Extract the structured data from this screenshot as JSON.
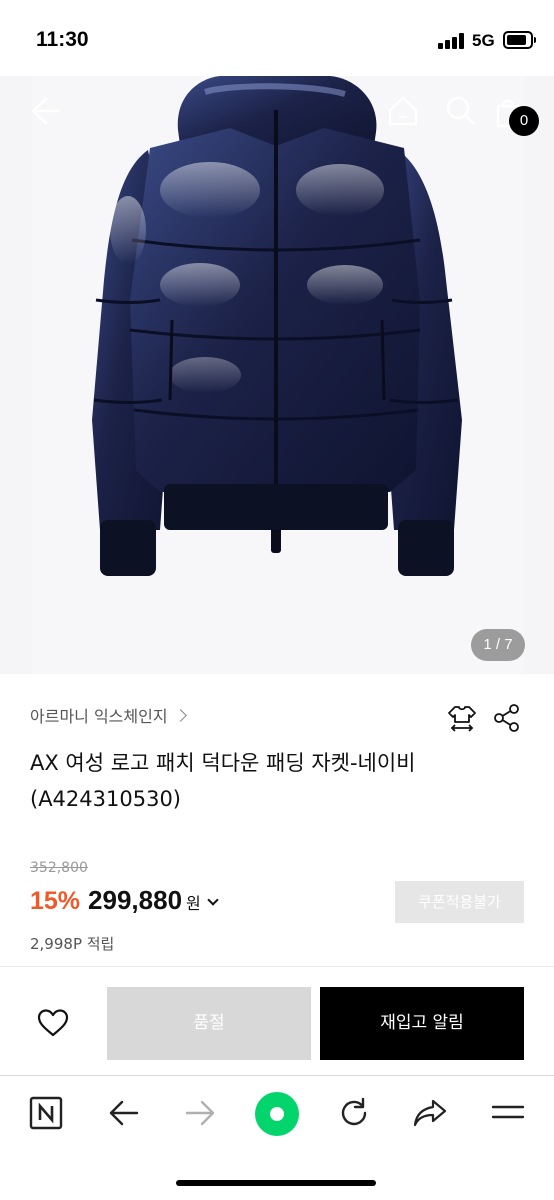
{
  "status_bar": {
    "time": "11:30",
    "network": "5G"
  },
  "header": {
    "back_icon": "arrow-left-icon",
    "home_icon": "home-icon",
    "search_icon": "search-icon",
    "cart_icon": "shopping-bag-icon",
    "cart_count": "0"
  },
  "gallery": {
    "image": "navy glossy puffer down jacket with hood",
    "page_indicator": "1 / 7"
  },
  "product": {
    "brand": "아르마니 익스체인지",
    "title": "AX 여성 로고 패치 덕다운 패딩 자켓-네이비 (A424310530)",
    "size_icon": "size-guide-icon",
    "share_icon": "share-icon",
    "original_price": "352,800",
    "discount": "15%",
    "price": "299,880",
    "currency": "원",
    "coupon_label": "쿠폰적용불가",
    "points": "2,998P 적립"
  },
  "actions": {
    "wish_icon": "heart-icon",
    "soldout_label": "품절",
    "restock_label": "재입고 알림"
  },
  "browser_bar": {
    "items": [
      "naver-n-icon",
      "back-arrow-icon",
      "forward-arrow-icon",
      "green-dot-icon",
      "refresh-icon",
      "share-arrow-icon",
      "menu-icon"
    ]
  },
  "colors": {
    "accent_discount": "#ef5a28",
    "jacket_navy": "#1c2248",
    "naver_green": "#03d46b",
    "button_black": "#000000",
    "button_disabled": "#d8d8d8"
  }
}
